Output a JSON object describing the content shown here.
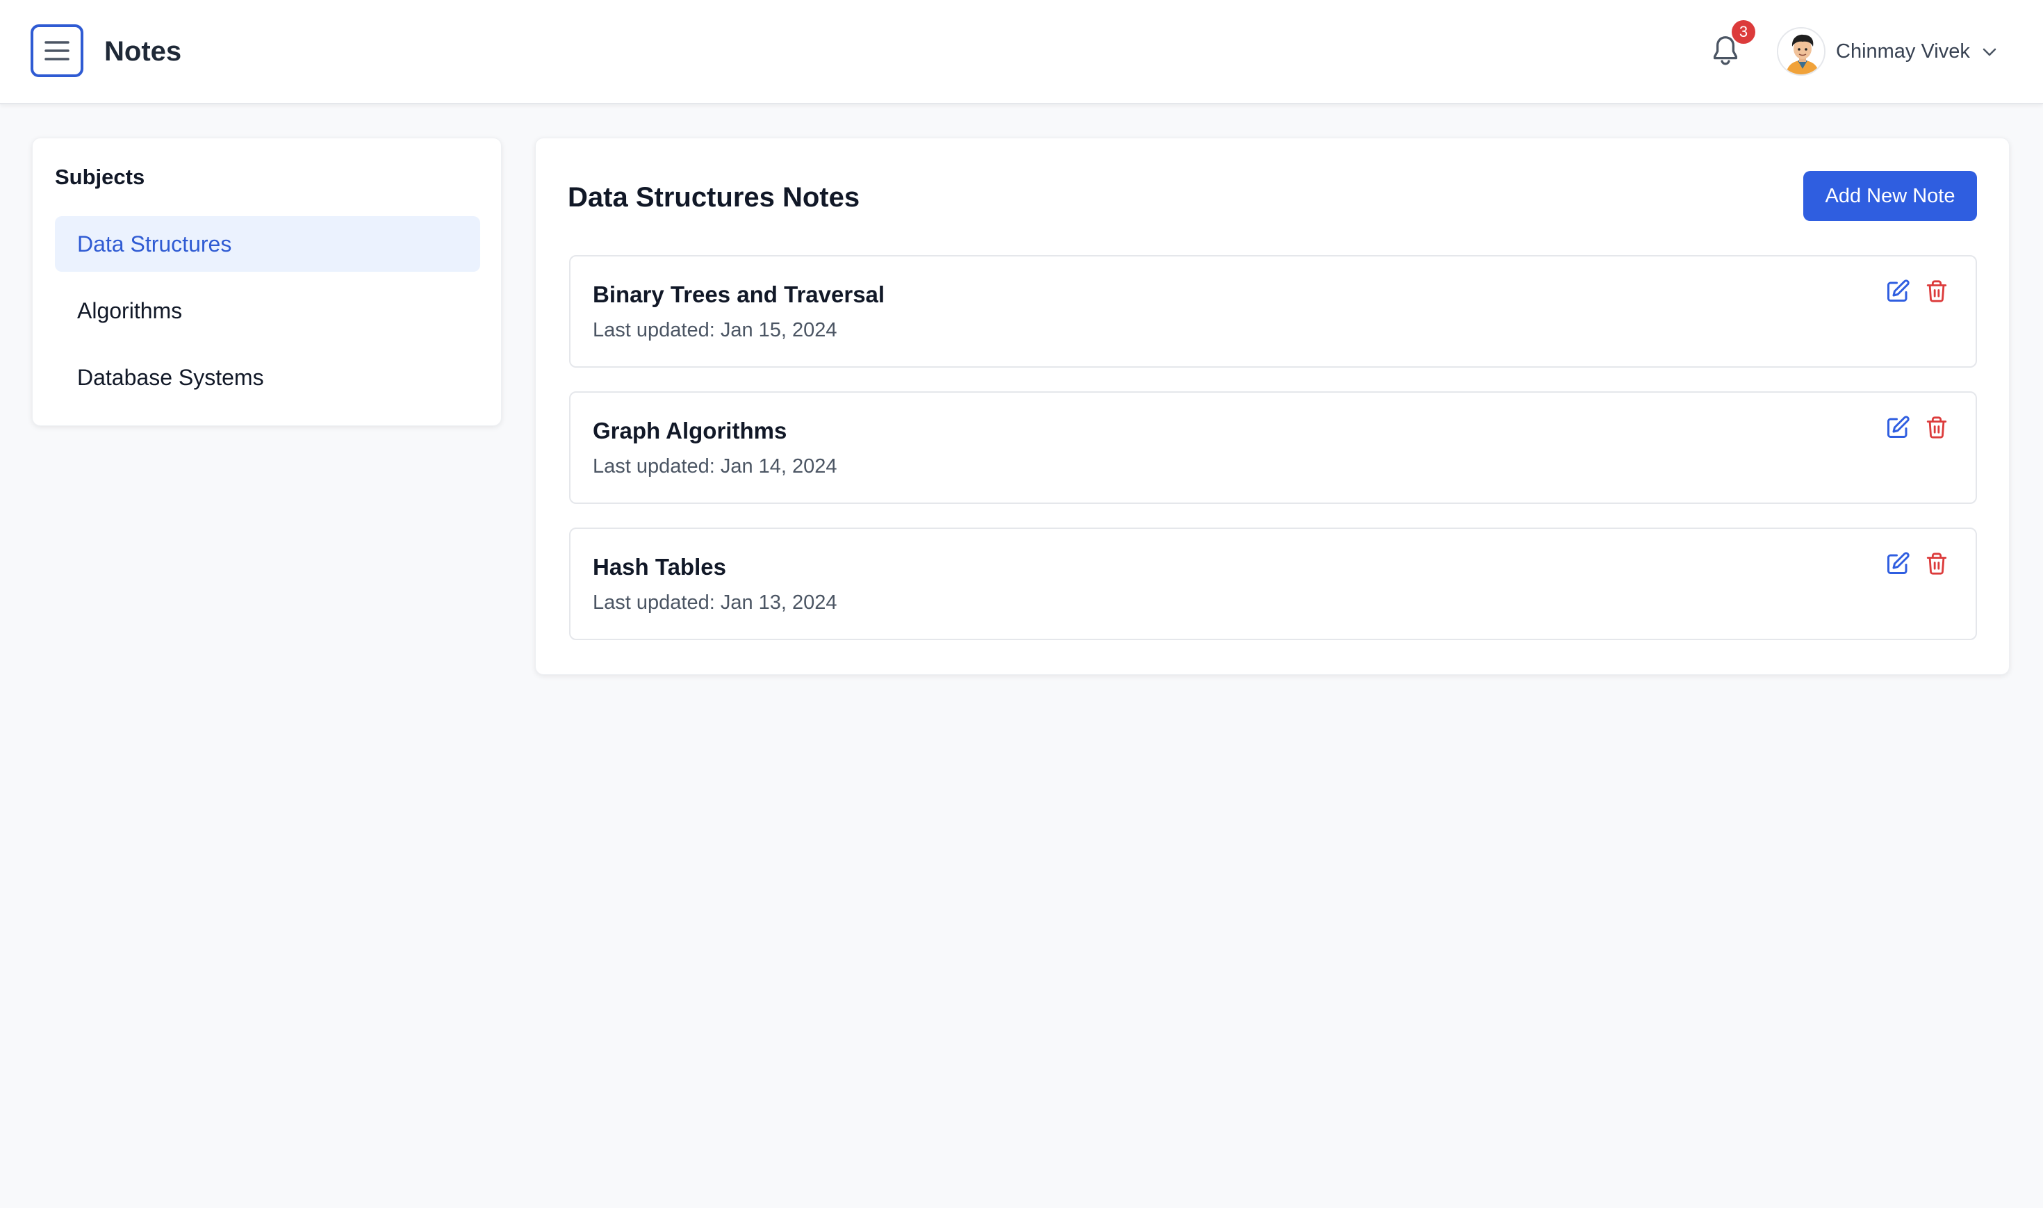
{
  "header": {
    "app_title": "Notes",
    "notification_count": "3",
    "user_name": "Chinmay Vivek",
    "icons": [
      "menu-icon",
      "bell-icon",
      "chevron-down-icon"
    ]
  },
  "sidebar": {
    "title": "Subjects",
    "items": [
      {
        "label": "Data Structures",
        "active": true
      },
      {
        "label": "Algorithms",
        "active": false
      },
      {
        "label": "Database Systems",
        "active": false
      }
    ]
  },
  "main": {
    "title": "Data Structures Notes",
    "add_button_label": "Add New Note",
    "notes": [
      {
        "title": "Binary Trees and Traversal",
        "date": "Last updated: Jan 15, 2024"
      },
      {
        "title": "Graph Algorithms",
        "date": "Last updated: Jan 14, 2024"
      },
      {
        "title": "Hash Tables",
        "date": "Last updated: Jan 13, 2024"
      }
    ]
  },
  "colors": {
    "accent": "#2f5ee0",
    "active_bg": "#ebf2fe",
    "danger": "#dc3b3b",
    "badge": "#dc3b3b"
  }
}
